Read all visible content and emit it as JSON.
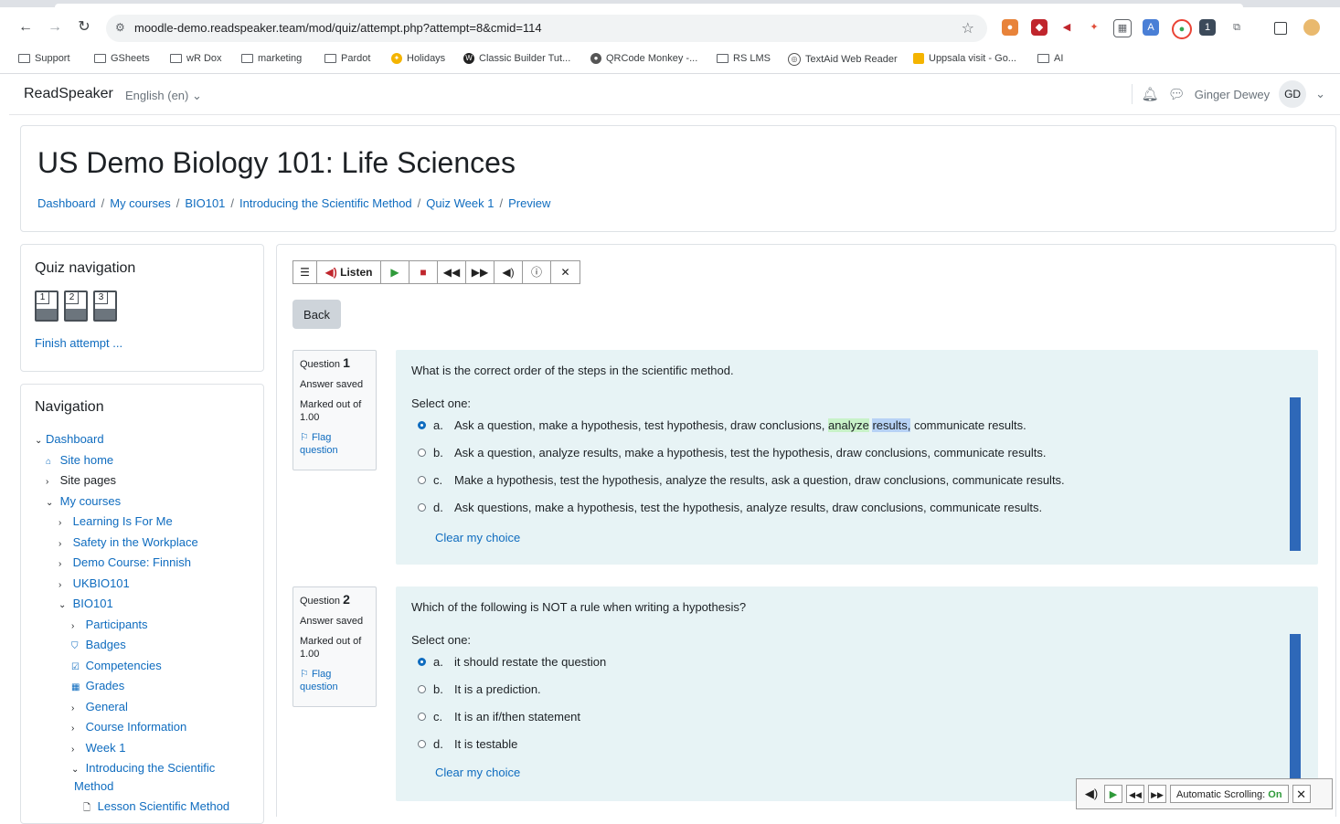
{
  "browser": {
    "url": "moodle-demo.readspeaker.team/mod/quiz/attempt.php?attempt=8&cmid=114",
    "bookmarks": [
      "Support",
      "GSheets",
      "wR Dox",
      "marketing",
      "Pardot",
      "Holidays",
      "Classic Builder Tut...",
      "QRCode Monkey -...",
      "RS LMS",
      "TextAid Web Reader",
      "Uppsala visit - Go...",
      "AI"
    ]
  },
  "site": {
    "brand": "ReadSpeaker",
    "language": "English (en)",
    "user_name": "Ginger Dewey",
    "user_initials": "GD"
  },
  "page": {
    "title": "US Demo Biology 101: Life Sciences",
    "breadcrumb": [
      "Dashboard",
      "My courses",
      "BIO101",
      "Introducing the Scientific Method",
      "Quiz Week 1",
      "Preview"
    ]
  },
  "quiz_nav": {
    "title": "Quiz navigation",
    "questions": [
      "1",
      "2",
      "3"
    ],
    "finish": "Finish attempt ..."
  },
  "navigation": {
    "title": "Navigation",
    "items": [
      {
        "label": "Dashboard",
        "prefix": "⌄"
      },
      {
        "label": "Site home",
        "prefix": "⌂"
      },
      {
        "label": "Site pages",
        "prefix": "›"
      },
      {
        "label": "My courses",
        "prefix": "⌄"
      },
      {
        "label": "Learning Is For Me",
        "prefix": "›"
      },
      {
        "label": "Safety in the Workplace",
        "prefix": "›"
      },
      {
        "label": "Demo Course: Finnish",
        "prefix": "›"
      },
      {
        "label": "UKBIO101",
        "prefix": "›"
      },
      {
        "label": "BIO101",
        "prefix": "⌄"
      },
      {
        "label": "Participants",
        "prefix": "›"
      },
      {
        "label": "Badges",
        "prefix": "⛉"
      },
      {
        "label": "Competencies",
        "prefix": "☑"
      },
      {
        "label": "Grades",
        "prefix": "▦"
      },
      {
        "label": "General",
        "prefix": "›"
      },
      {
        "label": "Course Information",
        "prefix": "›"
      },
      {
        "label": "Week 1",
        "prefix": "›"
      },
      {
        "label": "Introducing the Scientific",
        "prefix": "⌄"
      },
      {
        "label": "Method",
        "prefix": ""
      },
      {
        "label": "Lesson Scientific Method",
        "prefix": "🗋"
      }
    ]
  },
  "readspeaker": {
    "listen": "Listen",
    "back": "Back",
    "auto_scroll_label": "Automatic Scrolling:",
    "auto_scroll_state": "On"
  },
  "questions": [
    {
      "label": "Question",
      "number": "1",
      "status": "Answer saved",
      "marked": "Marked out of",
      "marks": "1.00",
      "flag": "Flag question",
      "text": "What is the correct order of the steps in the scientific method.",
      "select": "Select one:",
      "options": [
        {
          "letter": "a.",
          "pre": "Ask a question, make a hypothesis, test hypothesis, draw conclusions, ",
          "hl1": "analyze",
          "hl2": "results,",
          "post": " communicate results."
        },
        {
          "letter": "b.",
          "text": "Ask a question, analyze results, make a hypothesis, test the hypothesis, draw conclusions, communicate results."
        },
        {
          "letter": "c.",
          "text": "Make a hypothesis, test the hypothesis, analyze the results, ask a question, draw conclusions, communicate results."
        },
        {
          "letter": "d.",
          "text": "Ask questions, make a hypothesis, test the hypothesis, analyze results, draw conclusions, communicate results."
        }
      ],
      "clear": "Clear my choice"
    },
    {
      "label": "Question",
      "number": "2",
      "status": "Answer saved",
      "marked": "Marked out of",
      "marks": "1.00",
      "flag": "Flag question",
      "text": "Which of the following is NOT a rule when writing a hypothesis?",
      "select": "Select one:",
      "options": [
        {
          "letter": "a.",
          "text": "it should restate the question"
        },
        {
          "letter": "b.",
          "text": "It is a prediction."
        },
        {
          "letter": "c.",
          "text": "It is an if/then statement"
        },
        {
          "letter": "d.",
          "text": "It is testable"
        }
      ],
      "clear": "Clear my choice"
    }
  ]
}
